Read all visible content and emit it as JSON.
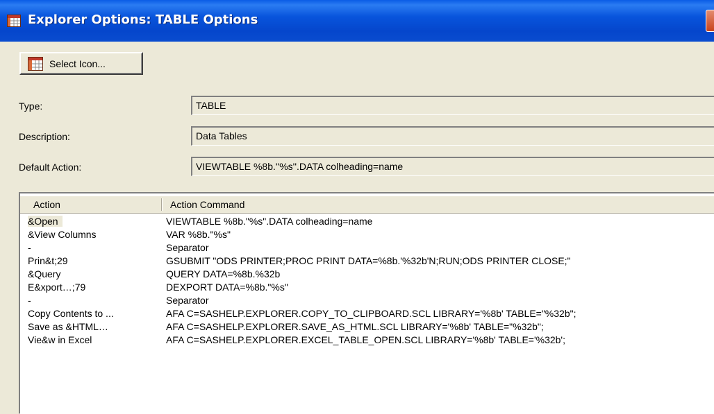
{
  "window": {
    "title": "Explorer Options: TABLE Options"
  },
  "select_icon_button": {
    "label": "Select Icon..."
  },
  "fields": {
    "type": {
      "label": "Type:",
      "value": "TABLE"
    },
    "description": {
      "label": "Description:",
      "value": "Data Tables"
    },
    "default_action": {
      "label": "Default Action:",
      "value": "VIEWTABLE %8b.''%s''.DATA colheading=name"
    }
  },
  "actions_table": {
    "columns": [
      "Action",
      "Action Command"
    ],
    "rows": [
      {
        "action": "&Open",
        "command": "VIEWTABLE %8b.\"%s\".DATA colheading=name",
        "selected": true
      },
      {
        "action": "&View Columns",
        "command": "VAR %8b.\"%s\""
      },
      {
        "action": "-",
        "command": "Separator"
      },
      {
        "action": "Prin&t;29",
        "command": "GSUBMIT \"ODS PRINTER;PROC PRINT DATA=%8b.'%32b'N;RUN;ODS PRINTER CLOSE;\""
      },
      {
        "action": "&Query",
        "command": "QUERY DATA=%8b.%32b"
      },
      {
        "action": "E&xport…;79",
        "command": "DEXPORT DATA=%8b.\"%s\""
      },
      {
        "action": "-",
        "command": "Separator"
      },
      {
        "action": "Copy Contents to ...",
        "command": "AFA C=SASHELP.EXPLORER.COPY_TO_CLIPBOARD.SCL LIBRARY='%8b' TABLE=\"%32b\";"
      },
      {
        "action": "Save as &HTML…",
        "command": "AFA C=SASHELP.EXPLORER.SAVE_AS_HTML.SCL LIBRARY='%8b' TABLE=\"%32b\";"
      },
      {
        "action": "Vie&w in Excel",
        "command": "AFA C=SASHELP.EXPLORER.EXCEL_TABLE_OPEN.SCL LIBRARY='%8b' TABLE='%32b';"
      }
    ]
  },
  "icons": {
    "title": "table-icon",
    "button": "table-icon",
    "close": "close-icon"
  },
  "colors": {
    "titlebar": "#0a4ccf",
    "face": "#ece9d8",
    "close": "#c9421c"
  }
}
